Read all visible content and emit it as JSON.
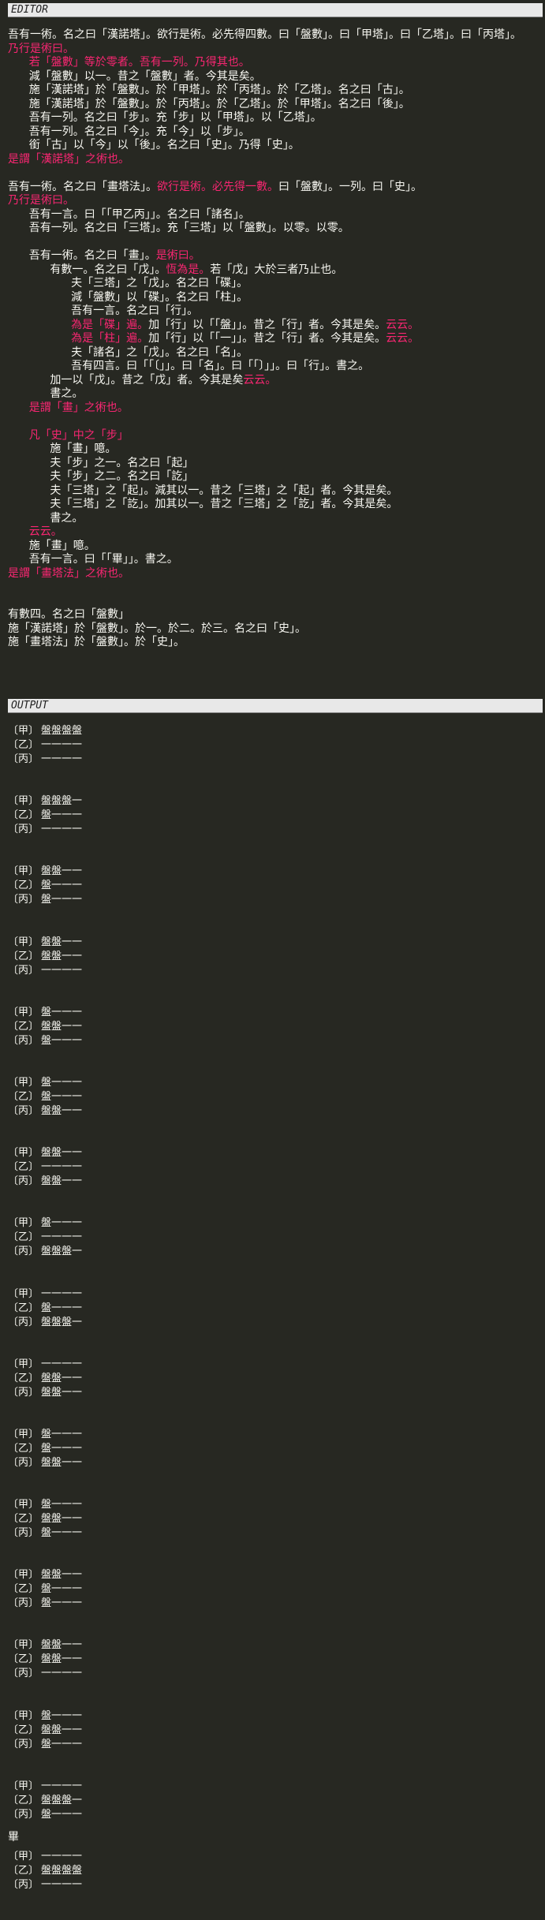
{
  "editor": {
    "header": "EDITOR",
    "lines": [
      [
        [
          "t",
          "吾有一術。名之曰「漢諾塔」。欲行是術。必先得四數。曰「盤數」。曰「甲塔」。曰「乙塔」。曰「丙塔」。"
        ]
      ],
      [
        [
          "k",
          "乃行是術曰。"
        ]
      ],
      [
        [
          "t",
          "      "
        ],
        [
          "k",
          "若「盤數」等於零者。吾有一列。乃得其也。"
        ]
      ],
      [
        [
          "t",
          "      減「盤數」以一。昔之「盤數」者。今其是矣。"
        ]
      ],
      [
        [
          "t",
          "      施「漢諾塔」於「盤數」。於「甲塔」。於「丙塔」。於「乙塔」。名之曰「古」。"
        ]
      ],
      [
        [
          "t",
          "      施「漢諾塔」於「盤數」。於「丙塔」。於「乙塔」。於「甲塔」。名之曰「後」。"
        ]
      ],
      [
        [
          "t",
          "      吾有一列。名之曰「步」。充「步」以「甲塔」。以「乙塔」。"
        ]
      ],
      [
        [
          "t",
          "      吾有一列。名之曰「今」。充「今」以「步」。"
        ]
      ],
      [
        [
          "t",
          "      銜「古」以「今」以「後」。名之曰「史」。乃得「史」。"
        ]
      ],
      [
        [
          "k",
          "是謂「漢諾塔」之術也。"
        ]
      ],
      [
        [
          "t",
          ""
        ]
      ],
      [
        [
          "t",
          "吾有一術。名之曰「畫塔法」。"
        ],
        [
          "k",
          "欲行是術。必先得一數。"
        ],
        [
          "t",
          "曰「盤數」。一列。曰「史」。"
        ]
      ],
      [
        [
          "k",
          "乃行是術曰。"
        ]
      ],
      [
        [
          "t",
          "      吾有一言。曰「「甲乙丙」」。名之曰「諸名」。"
        ]
      ],
      [
        [
          "t",
          "      吾有一列。名之曰「三塔」。充「三塔」以「盤數」。以零。以零。"
        ]
      ],
      [
        [
          "t",
          ""
        ]
      ],
      [
        [
          "t",
          "      吾有一術。名之曰「畫」。"
        ],
        [
          "k",
          "是術曰。"
        ]
      ],
      [
        [
          "t",
          "            有數一。名之曰「戊」。"
        ],
        [
          "k",
          "恆為是。"
        ],
        [
          "t",
          "若「戊」大於三者乃止也。"
        ]
      ],
      [
        [
          "t",
          "                  夫「三塔」之「戊」。名之曰「碟」。"
        ]
      ],
      [
        [
          "t",
          "                  減「盤數」以「碟」。名之曰「柱」。"
        ]
      ],
      [
        [
          "t",
          "                  吾有一言。名之曰「行」。"
        ]
      ],
      [
        [
          "t",
          "                  "
        ],
        [
          "k",
          "為是「碟」遍。"
        ],
        [
          "t",
          "加「行」以「「盤」」。昔之「行」者。今其是矣。"
        ],
        [
          "k",
          "云云。"
        ]
      ],
      [
        [
          "t",
          "                  "
        ],
        [
          "k",
          "為是「柱」遍。"
        ],
        [
          "t",
          "加「行」以「「一」」。昔之「行」者。今其是矣。"
        ],
        [
          "k",
          "云云。"
        ]
      ],
      [
        [
          "t",
          "                  夫「諸名」之「戊」。名之曰「名」。"
        ]
      ],
      [
        [
          "t",
          "                  吾有四言。曰「「〔」」。曰「名」。曰「「〕」」。曰「行」。書之。"
        ]
      ],
      [
        [
          "t",
          "            加一以「戊」。昔之「戊」者。今其是矣"
        ],
        [
          "k",
          "云云。"
        ]
      ],
      [
        [
          "t",
          "            書之。"
        ]
      ],
      [
        [
          "t",
          "      "
        ],
        [
          "k",
          "是謂「畫」之術也。"
        ]
      ],
      [
        [
          "t",
          ""
        ]
      ],
      [
        [
          "t",
          "      "
        ],
        [
          "k",
          "凡「史」中之「步」"
        ]
      ],
      [
        [
          "t",
          "            施「畫」噫。"
        ]
      ],
      [
        [
          "t",
          "            夫「步」之一。名之曰「起」"
        ]
      ],
      [
        [
          "t",
          "            夫「步」之二。名之曰「訖」"
        ]
      ],
      [
        [
          "t",
          "            夫「三塔」之「起」。減其以一。昔之「三塔」之「起」者。今其是矣。"
        ]
      ],
      [
        [
          "t",
          "            夫「三塔」之「訖」。加其以一。昔之「三塔」之「訖」者。今其是矣。"
        ]
      ],
      [
        [
          "t",
          "            書之。"
        ]
      ],
      [
        [
          "t",
          "      "
        ],
        [
          "k",
          "云云。"
        ]
      ],
      [
        [
          "t",
          "      施「畫」噫。"
        ]
      ],
      [
        [
          "t",
          "      吾有一言。曰「「畢」」。書之。"
        ]
      ],
      [
        [
          "k",
          "是謂「畫塔法」之術也。"
        ]
      ],
      [
        [
          "t",
          ""
        ]
      ],
      [
        [
          "t",
          ""
        ]
      ],
      [
        [
          "t",
          "有數四。名之曰「盤數」"
        ]
      ],
      [
        [
          "t",
          "施「漢諾塔」於「盤數」。於一。於二。於三。名之曰「史」。"
        ]
      ],
      [
        [
          "t",
          "施「畫塔法」於「盤數」。於「史」。"
        ]
      ]
    ]
  },
  "output": {
    "header": "OUTPUT",
    "labels": [
      "〔甲〕",
      "〔乙〕",
      "〔丙〕"
    ],
    "states": [
      [
        4,
        0,
        0
      ],
      [
        3,
        1,
        0
      ],
      [
        2,
        1,
        1
      ],
      [
        2,
        2,
        0
      ],
      [
        1,
        2,
        1
      ],
      [
        1,
        1,
        2
      ],
      [
        2,
        0,
        2
      ],
      [
        1,
        0,
        3
      ],
      [
        0,
        1,
        3
      ],
      [
        0,
        2,
        2
      ],
      [
        1,
        1,
        2
      ],
      [
        1,
        2,
        1
      ],
      [
        2,
        1,
        1
      ],
      [
        2,
        2,
        0
      ],
      [
        1,
        2,
        1
      ],
      [
        0,
        3,
        1
      ],
      [
        0,
        4,
        0
      ]
    ],
    "disk": "盤",
    "empty": "一",
    "end": "畢"
  }
}
